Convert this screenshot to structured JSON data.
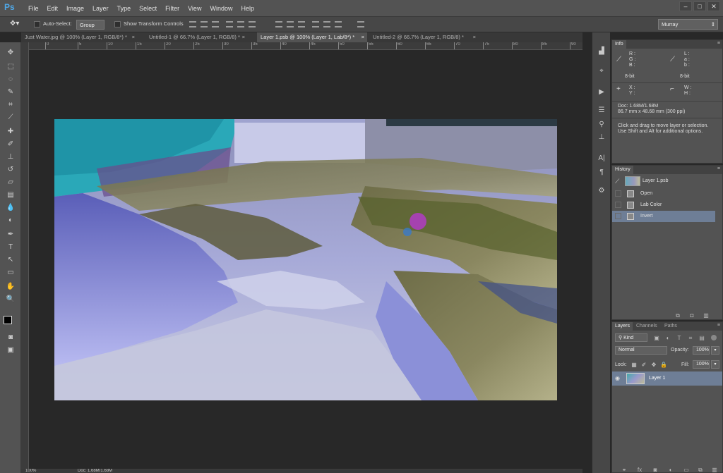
{
  "app": {
    "logo": "Ps"
  },
  "menu": [
    "File",
    "Edit",
    "Image",
    "Layer",
    "Type",
    "Select",
    "Filter",
    "View",
    "Window",
    "Help"
  ],
  "window_controls": {
    "minimize": "–",
    "maximize": "□",
    "close": "✕"
  },
  "options_bar": {
    "auto_select_label": "Auto-Select:",
    "auto_select_value": "Group",
    "show_transform_label": "Show Transform Controls",
    "workspace": "Murray"
  },
  "tabs": [
    {
      "label": "Just Water.jpg @ 100% (Layer 1, RGB/8*) *",
      "active": false
    },
    {
      "label": "Untitled-1 @ 66.7% (Layer 1, RGB/8) *",
      "active": false
    },
    {
      "label": "Layer 1.psb @ 100% (Layer 1, Lab/8*) *",
      "active": true
    },
    {
      "label": "Untitled-2 @ 66.7% (Layer 1, RGB/8) *",
      "active": false
    }
  ],
  "ruler_ticks": [
    "0",
    "5",
    "10",
    "15",
    "20",
    "25",
    "30",
    "35",
    "40",
    "45",
    "50",
    "55",
    "60",
    "65",
    "70",
    "75",
    "80",
    "85",
    "90"
  ],
  "info_panel": {
    "tab": "Info",
    "rgb_labels": [
      "R :",
      "G :",
      "B :"
    ],
    "lab_labels": [
      "L :",
      "a :",
      "b :"
    ],
    "bit_left": "8-bit",
    "bit_right": "8-bit",
    "xy_labels": [
      "X :",
      "Y :"
    ],
    "wh_labels": [
      "W :",
      "H :"
    ],
    "doc": "Doc: 1.68M/1.68M",
    "dimensions": "86.7 mm x 48.68 mm (300 ppi)",
    "hint1": "Click and drag to move layer or selection.",
    "hint2": "Use Shift and Alt for additional options."
  },
  "history_panel": {
    "tab": "History",
    "snapshot": "Layer 1.psb",
    "steps": [
      {
        "label": "Open",
        "selected": false
      },
      {
        "label": "Lab Color",
        "selected": false
      },
      {
        "label": "Invert",
        "selected": true
      }
    ]
  },
  "layers_panel": {
    "tabs": [
      "Layers",
      "Channels",
      "Paths"
    ],
    "kind": "Kind",
    "blend_mode": "Normal",
    "opacity_label": "Opacity:",
    "opacity": "100%",
    "lock_label": "Lock:",
    "fill_label": "Fill:",
    "fill": "100%",
    "layers": [
      {
        "name": "Layer 1",
        "visible": true,
        "selected": true
      }
    ]
  },
  "status_bar": {
    "zoom": "100%",
    "doc": "Doc: 1.68M/1.68M"
  },
  "colors": {
    "accent_selected": "#6e7e96",
    "panel_bg": "#535353",
    "canvas_bg": "#282828"
  }
}
